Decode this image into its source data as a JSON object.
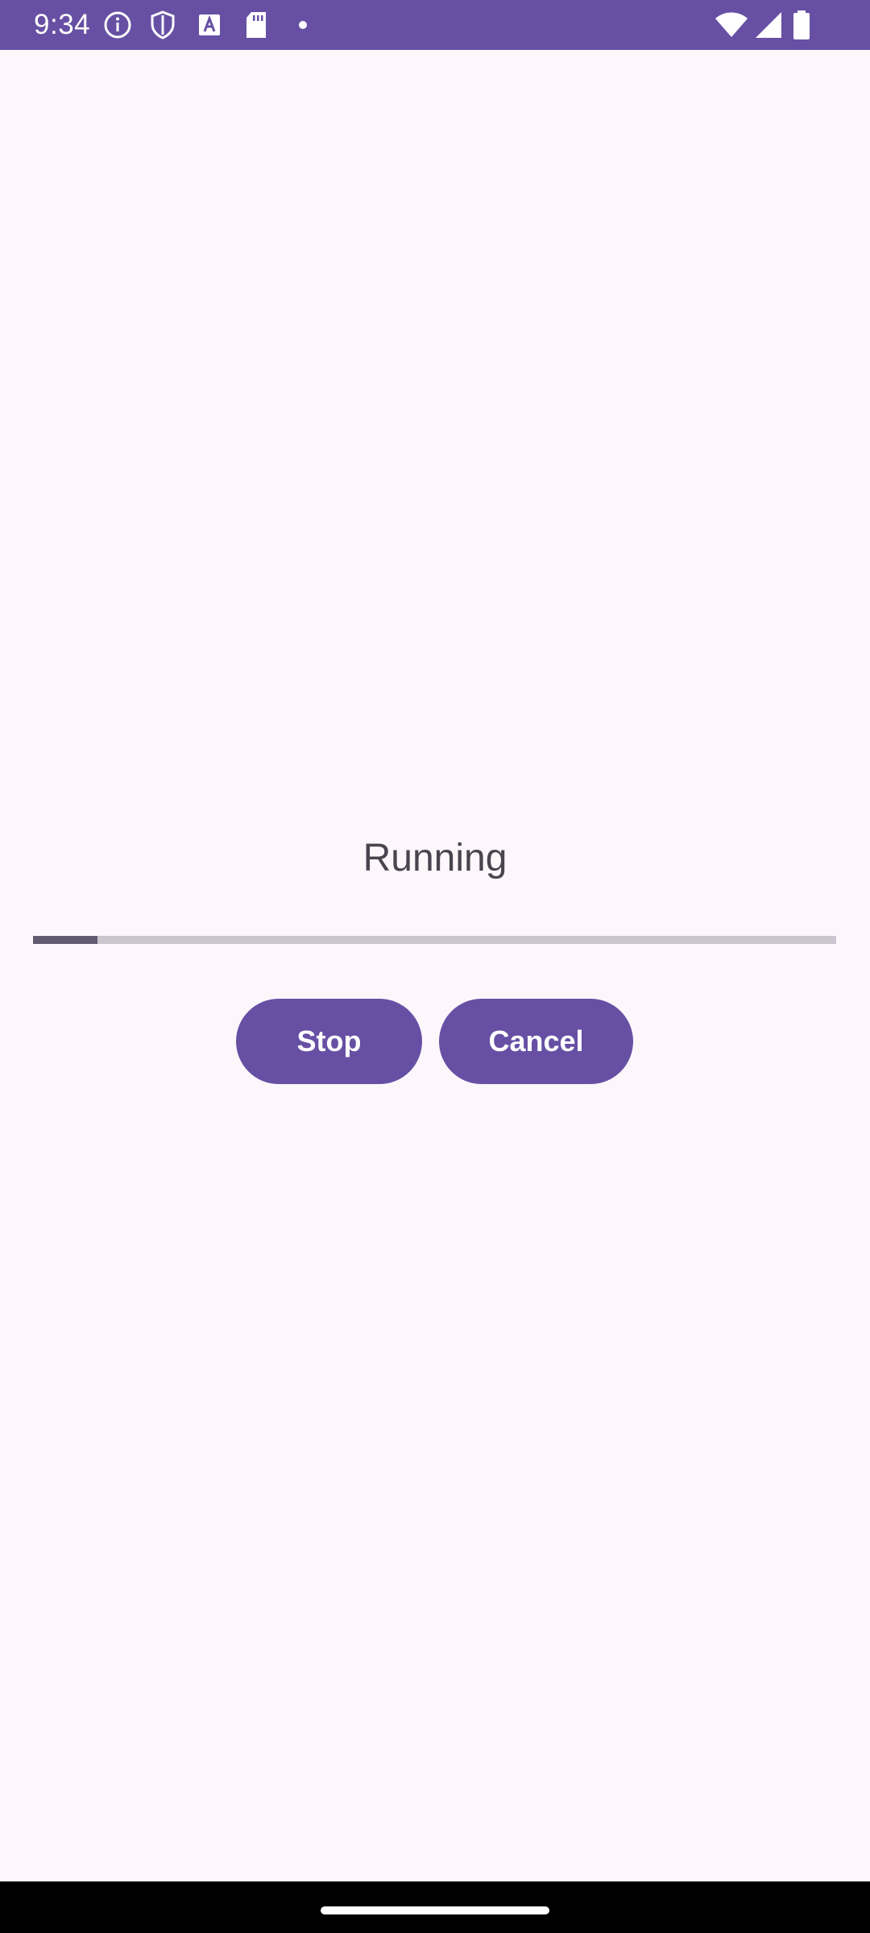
{
  "status_bar": {
    "time": "9:34",
    "left_icons": [
      "info-icon",
      "shield-icon",
      "font-a-icon",
      "sd-card-icon",
      "dot-icon"
    ],
    "right_icons": [
      "wifi-icon",
      "signal-icon",
      "battery-icon"
    ],
    "color": "#6750a4"
  },
  "main": {
    "status_label": "Running",
    "progress": 0.08,
    "stop_label": "Stop",
    "cancel_label": "Cancel"
  },
  "theme": {
    "primary": "#6750a4",
    "background": "#fdf7fc",
    "progress_track": "#cbc5cf",
    "progress_fill": "#625b71"
  }
}
